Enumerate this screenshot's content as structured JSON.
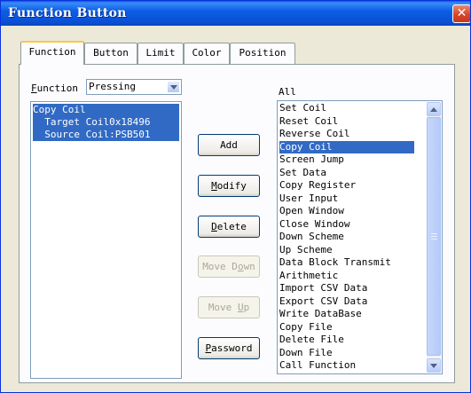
{
  "window": {
    "title": "Function Button",
    "close_glyph": "✕"
  },
  "tabs": [
    {
      "label": "Function",
      "active": true
    },
    {
      "label": "Button",
      "active": false
    },
    {
      "label": "Limit",
      "active": false
    },
    {
      "label": "Color",
      "active": false
    },
    {
      "label": "Position",
      "active": false
    }
  ],
  "function_select": {
    "label_prefix": "F",
    "label_rest": "unction",
    "value": "Pressing"
  },
  "left_list": [
    "Copy Coil",
    "  Target Coil0x18496",
    "  Source Coil:PSB501"
  ],
  "buttons": [
    {
      "name": "add-button",
      "mnemonic": "",
      "rest": "Add",
      "enabled": true
    },
    {
      "name": "modify-button",
      "mnemonic": "M",
      "rest": "odify",
      "enabled": true
    },
    {
      "name": "delete-button",
      "mnemonic": "D",
      "rest": "elete",
      "enabled": true
    },
    {
      "name": "move-down-button",
      "pre": "Move D",
      "mnemonic": "o",
      "rest": "wn",
      "enabled": false
    },
    {
      "name": "move-up-button",
      "pre": "Move ",
      "mnemonic": "U",
      "rest": "p",
      "enabled": false
    },
    {
      "name": "password-button",
      "mnemonic": "P",
      "rest": "assword",
      "enabled": true
    }
  ],
  "all_list": {
    "label": "All",
    "selected": "Copy Coil",
    "items": [
      "Set Coil",
      "Reset Coil",
      "Reverse Coil",
      "Copy Coil",
      "Screen Jump",
      "Set Data",
      "Copy Register",
      "User Input",
      "Open Window",
      "Close Window",
      "Down Scheme",
      "Up Scheme",
      "Data Block Transmit",
      "Arithmetic",
      "Import CSV Data",
      "Export CSV Data",
      "Write DataBase",
      "Copy File",
      "Delete File",
      "Down File",
      "Call Function"
    ]
  },
  "colors": {
    "selection": "#316ac5",
    "titlebar": "#0a4fd4",
    "dialog_bg": "#ece9d8"
  }
}
